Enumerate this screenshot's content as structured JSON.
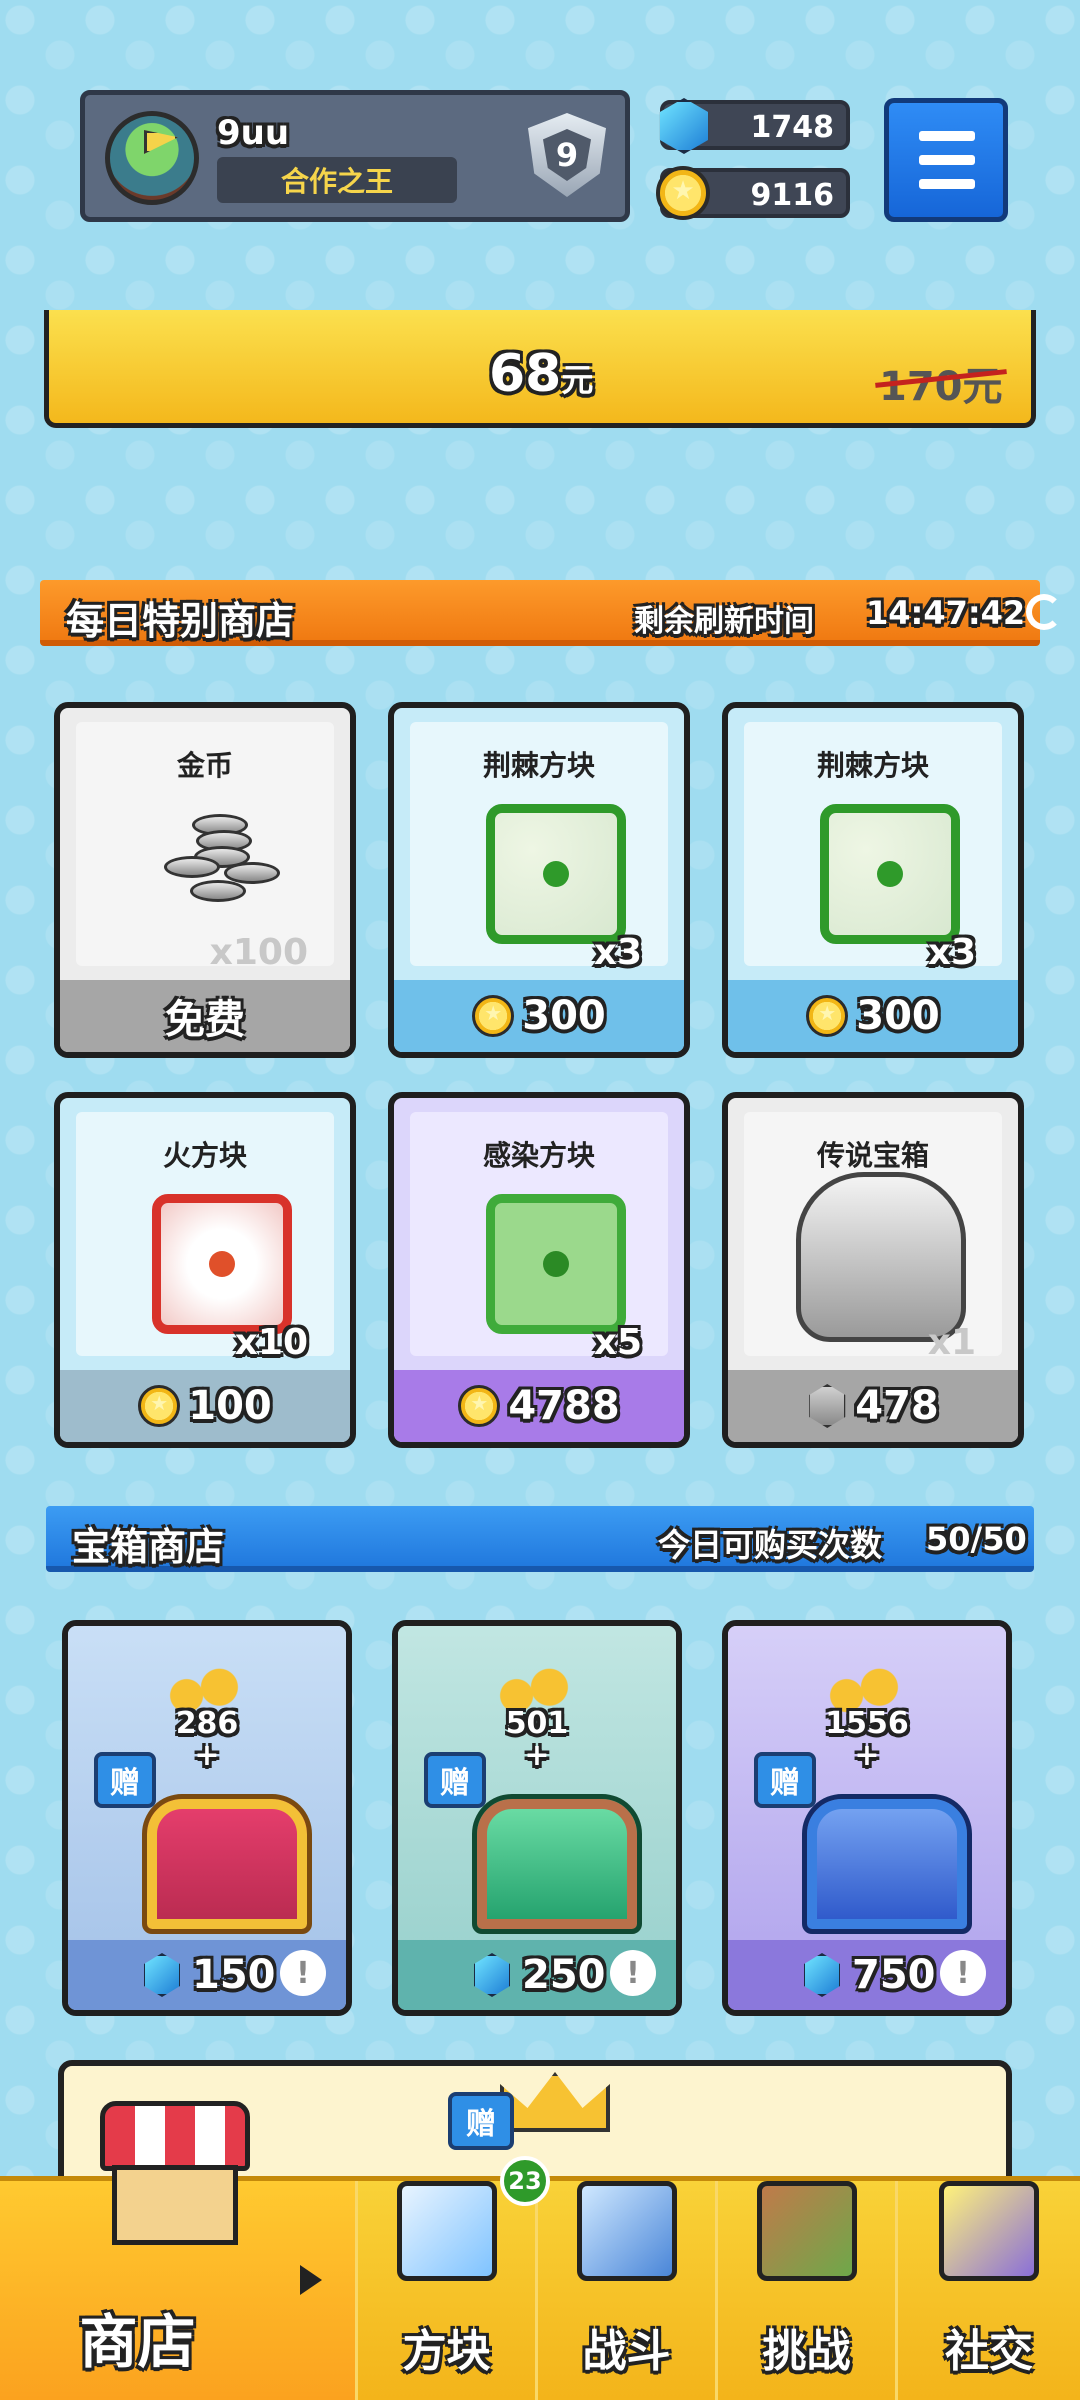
{
  "header": {
    "username": "9uu",
    "title": "合作之王",
    "rank": "9",
    "gems": "1748",
    "coins": "9116"
  },
  "promo": {
    "price": "68",
    "price_unit": "元",
    "old_price": "170元"
  },
  "daily_shop": {
    "title": "每日特别商店",
    "refresh_label": "剩余刷新时间",
    "refresh_time": "14:47:42",
    "items": [
      {
        "name": "金币",
        "qty": "x100",
        "price": "免费",
        "icon": "silver-coins-icon"
      },
      {
        "name": "荆棘方块",
        "qty": "x3",
        "price": "300",
        "icon": "thorn-dice-icon"
      },
      {
        "name": "荆棘方块",
        "qty": "x3",
        "price": "300",
        "icon": "thorn-dice-icon"
      },
      {
        "name": "火方块",
        "qty": "x10",
        "price": "100",
        "icon": "fire-dice-icon"
      },
      {
        "name": "感染方块",
        "qty": "x5",
        "price": "4788",
        "icon": "infect-dice-icon"
      },
      {
        "name": "传说宝箱",
        "qty": "x1",
        "price": "478",
        "icon": "legendary-chest-icon"
      }
    ]
  },
  "chest_shop": {
    "title": "宝箱商店",
    "buy_label": "今日可购买次数",
    "buy_count": "50/50",
    "chests": [
      {
        "amount": "286",
        "plus": "+",
        "gift": "赠",
        "price": "150",
        "info": "!",
        "color": "#f3b41a"
      },
      {
        "amount": "501",
        "plus": "+",
        "gift": "赠",
        "price": "250",
        "info": "!",
        "color": "#2fbf7f"
      },
      {
        "amount": "1556",
        "plus": "+",
        "gift": "赠",
        "price": "750",
        "info": "!",
        "color": "#3a6ed8"
      }
    ]
  },
  "special": {
    "gift": "赠",
    "badge": "23"
  },
  "nav": {
    "shop": "商店",
    "dice": "方块",
    "battle": "战斗",
    "challenge": "挑战",
    "social": "社交"
  }
}
